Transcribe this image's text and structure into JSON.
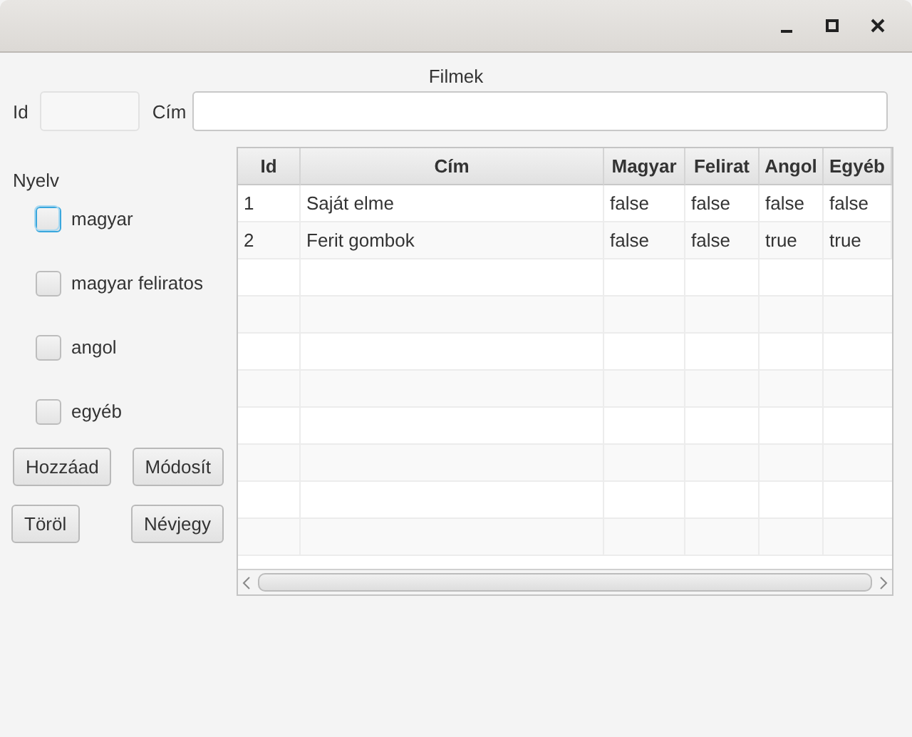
{
  "heading": "Filmek",
  "fields": [
    {
      "label": "Id",
      "disabled": true
    },
    {
      "label": "Cím",
      "disabled": false
    }
  ],
  "language": {
    "label": "Nyelv",
    "options": [
      {
        "label": "magyar",
        "checked": false,
        "focused": true
      },
      {
        "label": "magyar feliratos",
        "checked": false,
        "focused": false
      },
      {
        "label": "angol",
        "checked": false,
        "focused": false
      },
      {
        "label": "egyéb",
        "checked": false,
        "focused": false
      }
    ]
  },
  "buttons": [
    [
      "Hozzáad",
      "Módosít"
    ],
    [
      "Töröl",
      "Névjegy"
    ]
  ],
  "table": {
    "columns": [
      "Id",
      "Cím",
      "Magyar",
      "Felirat",
      "Angol",
      "Egyéb"
    ],
    "rows": [
      [
        "1",
        "Saját elme",
        "false",
        "false",
        "false",
        "false"
      ],
      [
        "2",
        "Ferit gombok",
        "false",
        "false",
        "true",
        "true"
      ]
    ]
  }
}
